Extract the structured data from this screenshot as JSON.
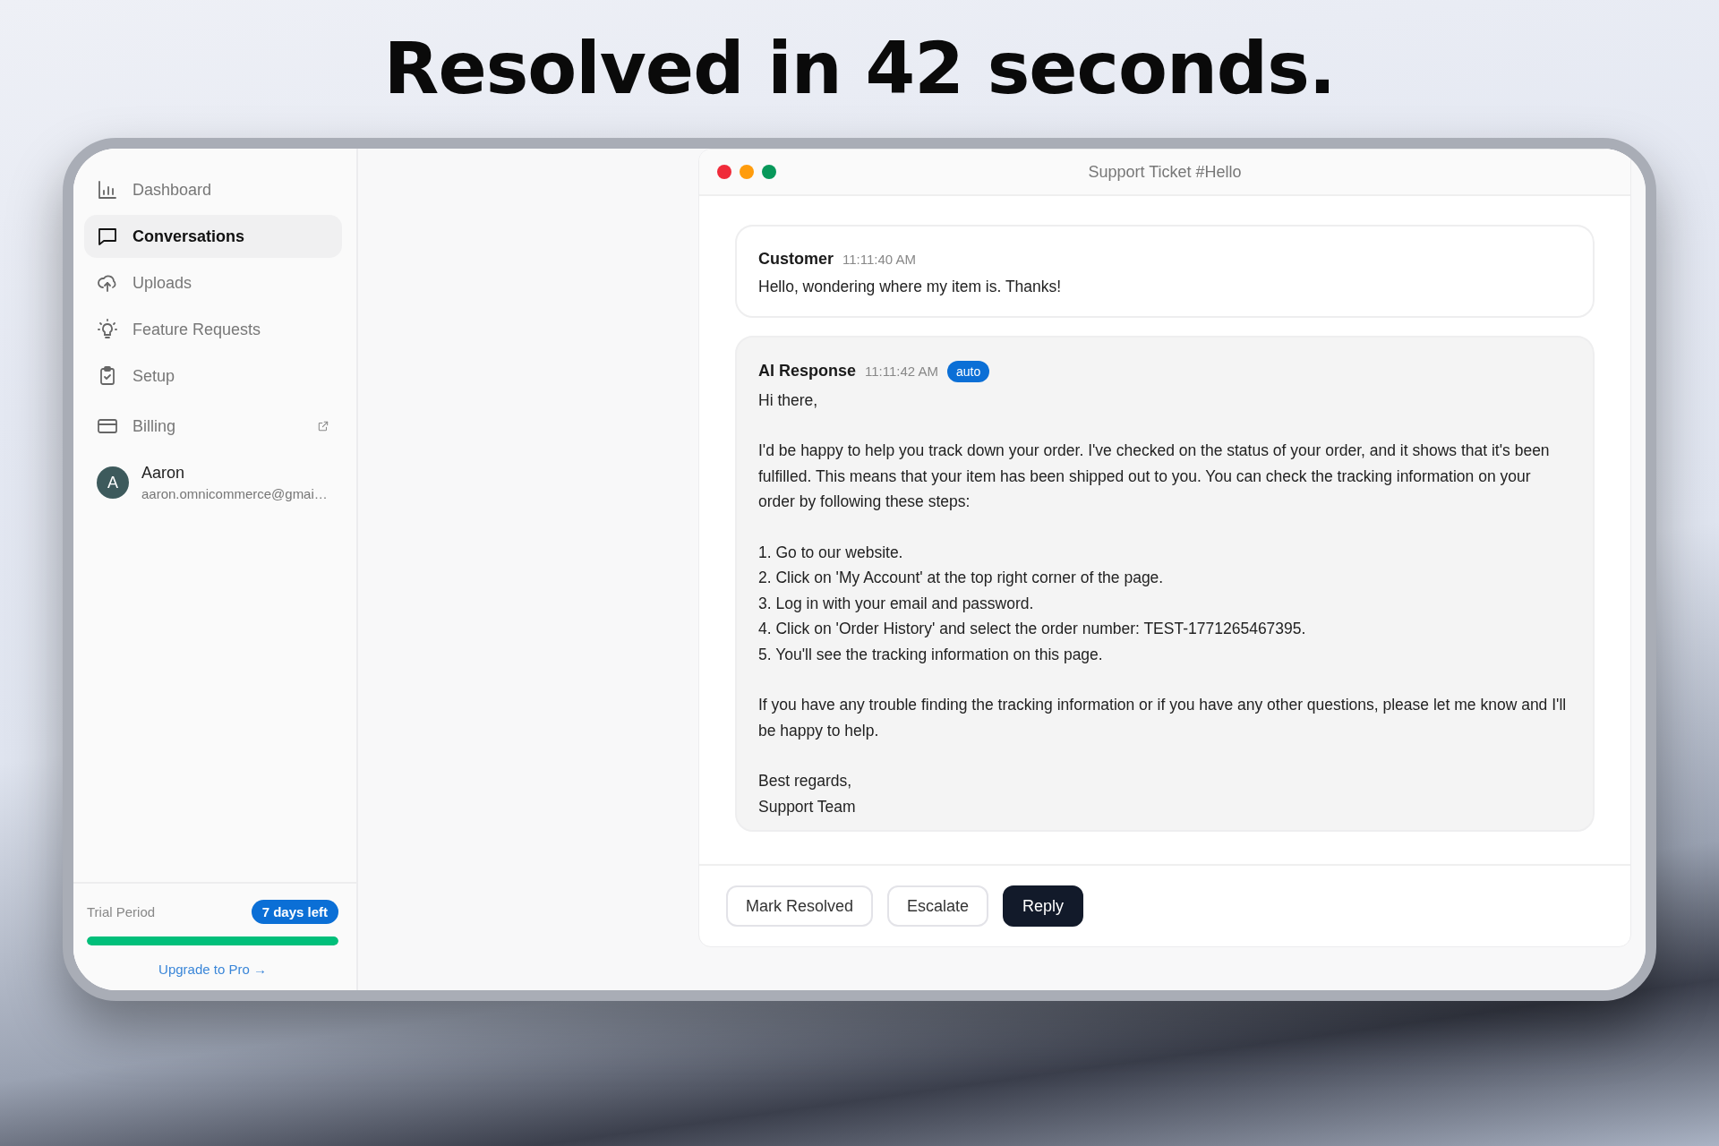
{
  "headline": "Resolved in 42 seconds.",
  "sidebar": {
    "items": [
      {
        "label": "Dashboard",
        "selected": false,
        "external": false
      },
      {
        "label": "Conversations",
        "selected": true,
        "external": false
      },
      {
        "label": "Uploads",
        "selected": false,
        "external": false
      },
      {
        "label": "Feature Requests",
        "selected": false,
        "external": false
      },
      {
        "label": "Setup",
        "selected": false,
        "external": false
      },
      {
        "label": "Billing",
        "selected": false,
        "external": true
      }
    ],
    "user": {
      "initial": "A",
      "name": "Aaron",
      "email": "aaron.omnicommerce@gmai…"
    },
    "trial": {
      "label": "Trial Period",
      "badge": "7 days left",
      "level": 1,
      "link": "Upgrade to Pro →"
    }
  },
  "window": {
    "title": "Support Ticket #Hello",
    "messages": [
      {
        "kind": "customer",
        "author": "Customer",
        "time": "11:11:40 AM",
        "blocks": [
          [
            "Hello, wondering where my item is. Thanks!"
          ]
        ]
      },
      {
        "kind": "ai",
        "author": "AI Response",
        "time": "11:11:42 AM",
        "tag": "auto",
        "blocks": [
          [
            "Hi there,"
          ],
          [
            "I'd be happy to help you track down your order. I've checked on the status of your order, and it shows that it's been fulfilled. This means that your item has been shipped out to you. You can check the tracking information on your order by following these steps:"
          ],
          [
            "1. Go to our website.",
            "2. Click on 'My Account' at the top right corner of the page.",
            "3. Log in with your email and password.",
            "4. Click on 'Order History' and select the order number: TEST-1771265467395.",
            "5. You'll see the tracking information on this page."
          ],
          [
            "If you have any trouble finding the tracking information or if you have any other questions, please let me know and I'll be happy to help."
          ],
          [
            "Best regards,",
            "Support Team"
          ]
        ]
      }
    ],
    "buttons": [
      {
        "label": "Mark Resolved",
        "kind": "outline"
      },
      {
        "label": "Escalate",
        "kind": "outline"
      },
      {
        "label": "Reply",
        "kind": "primary"
      }
    ]
  }
}
